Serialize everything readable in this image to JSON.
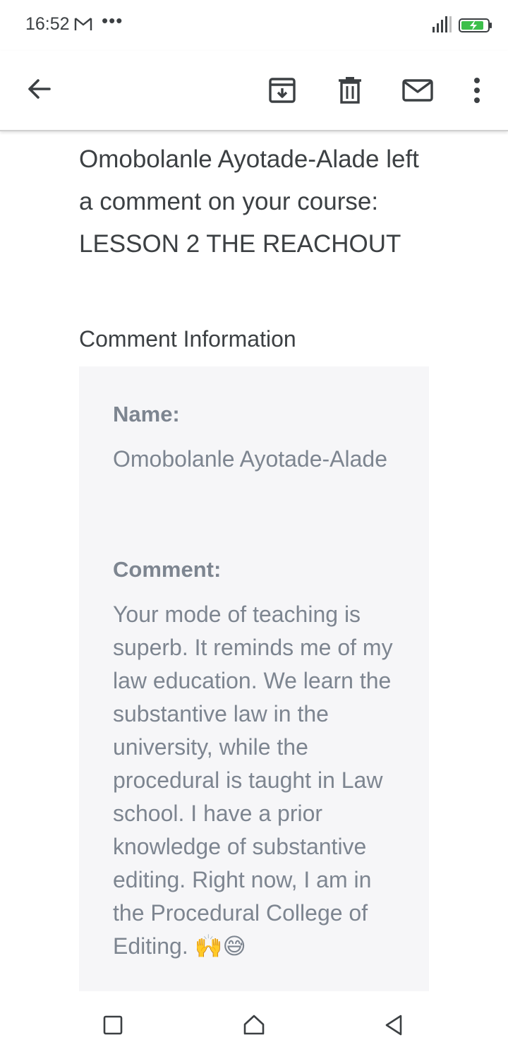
{
  "status_bar": {
    "time": "16:52",
    "more_indicator": "•••",
    "icons": [
      "gmail-notification-icon",
      "signal-icon",
      "battery-charging-icon"
    ],
    "battery_color": "#3dbf4b"
  },
  "app_bar": {
    "icons": [
      "back-arrow-icon",
      "archive-icon",
      "delete-icon",
      "mail-icon",
      "more-vert-icon"
    ]
  },
  "email": {
    "heading": "Omobolanle Ayotade-Alade left a comment on your course: LESSON 2 THE REACHOUT",
    "section_label": "Comment Information",
    "name_label": "Name:",
    "name_value": "Omobolanle Ayotade-Alade",
    "comment_label": "Comment:",
    "comment_value": "Your mode of teaching is superb. It reminds me of my law education. We learn the substantive law in the university, while the procedural is taught in Law school. I have a prior knowledge of substantive editing. Right now, I am in the Procedural College of Editing. 🙌😅"
  },
  "nav_bar": {
    "icons": [
      "recents-square-icon",
      "home-circle-icon",
      "back-triangle-icon"
    ]
  },
  "colors": {
    "text_primary": "#3c4043",
    "text_muted": "#7d8590",
    "card_bg": "#f6f6f8"
  }
}
